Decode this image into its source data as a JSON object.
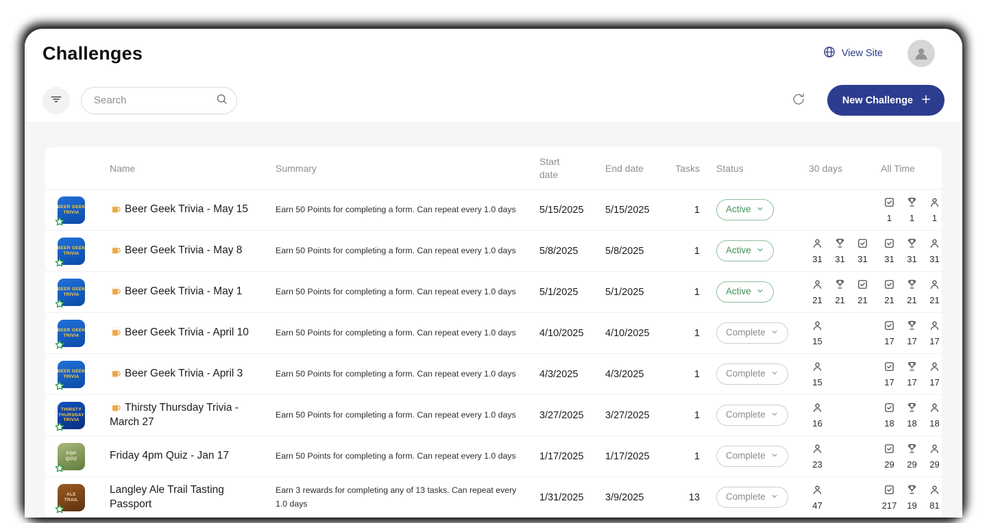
{
  "colors": {
    "accent": "#2c3d8f",
    "active": "#3f9257",
    "complete": "#8b8b8b"
  },
  "header": {
    "title": "Challenges",
    "view_site_label": "View Site"
  },
  "toolbar": {
    "search_placeholder": "Search",
    "new_challenge_label": "New Challenge"
  },
  "table": {
    "headers": {
      "name": "Name",
      "summary": "Summary",
      "start": "Start date",
      "end": "End date",
      "tasks": "Tasks",
      "status": "Status",
      "days30": "30 days",
      "all_time": "All Time"
    },
    "rows": [
      {
        "thumb": {
          "bg_top": "#2270d8",
          "bg_bottom": "#0b4ba8",
          "fg": "#ffce3c",
          "lines": [
            "BEER GEEK",
            "TRIVIA"
          ]
        },
        "beer_icon": true,
        "name": "Beer Geek Trivia - May 15",
        "summary": "Earn 50 Points for completing a form. Can repeat every 1.0 days",
        "start": "5/15/2025",
        "end": "5/15/2025",
        "tasks": "1",
        "status": {
          "label": "Active",
          "kind": "active"
        },
        "stats_30": [],
        "stats_all": [
          {
            "icon": "check",
            "value": "1"
          },
          {
            "icon": "trophy",
            "value": "1"
          },
          {
            "icon": "person",
            "value": "1"
          }
        ]
      },
      {
        "thumb": {
          "bg_top": "#2270d8",
          "bg_bottom": "#0b4ba8",
          "fg": "#ffce3c",
          "lines": [
            "BEER GEEK",
            "TRIVIA"
          ]
        },
        "beer_icon": true,
        "name": "Beer Geek Trivia - May 8",
        "summary": "Earn 50 Points for completing a form. Can repeat every 1.0 days",
        "start": "5/8/2025",
        "end": "5/8/2025",
        "tasks": "1",
        "status": {
          "label": "Active",
          "kind": "active"
        },
        "stats_30": [
          {
            "icon": "person",
            "value": "31"
          },
          {
            "icon": "trophy",
            "value": "31"
          },
          {
            "icon": "check",
            "value": "31"
          }
        ],
        "stats_all": [
          {
            "icon": "check",
            "value": "31"
          },
          {
            "icon": "trophy",
            "value": "31"
          },
          {
            "icon": "person",
            "value": "31"
          }
        ]
      },
      {
        "thumb": {
          "bg_top": "#2270d8",
          "bg_bottom": "#0b4ba8",
          "fg": "#ffce3c",
          "lines": [
            "BEER GEEK",
            "TRIVIA"
          ]
        },
        "beer_icon": true,
        "name": "Beer Geek Trivia - May 1",
        "summary": "Earn 50 Points for completing a form. Can repeat every 1.0 days",
        "start": "5/1/2025",
        "end": "5/1/2025",
        "tasks": "1",
        "status": {
          "label": "Active",
          "kind": "active"
        },
        "stats_30": [
          {
            "icon": "person",
            "value": "21"
          },
          {
            "icon": "trophy",
            "value": "21"
          },
          {
            "icon": "check",
            "value": "21"
          }
        ],
        "stats_all": [
          {
            "icon": "check",
            "value": "21"
          },
          {
            "icon": "trophy",
            "value": "21"
          },
          {
            "icon": "person",
            "value": "21"
          }
        ]
      },
      {
        "thumb": {
          "bg_top": "#2270d8",
          "bg_bottom": "#0b4ba8",
          "fg": "#ffce3c",
          "lines": [
            "BEER GEEK",
            "TRIVIA"
          ]
        },
        "beer_icon": true,
        "name": "Beer Geek Trivia - April 10",
        "summary": "Earn 50 Points for completing a form. Can repeat every 1.0 days",
        "start": "4/10/2025",
        "end": "4/10/2025",
        "tasks": "1",
        "status": {
          "label": "Complete",
          "kind": "complete"
        },
        "stats_30": [
          {
            "icon": "person",
            "value": "15"
          }
        ],
        "stats_all": [
          {
            "icon": "check",
            "value": "17"
          },
          {
            "icon": "trophy",
            "value": "17"
          },
          {
            "icon": "person",
            "value": "17"
          }
        ]
      },
      {
        "thumb": {
          "bg_top": "#2270d8",
          "bg_bottom": "#0b4ba8",
          "fg": "#ffce3c",
          "lines": [
            "BEER GEEK",
            "TRIVIA"
          ]
        },
        "beer_icon": true,
        "name": "Beer Geek Trivia - April 3",
        "summary": "Earn 50 Points for completing a form. Can repeat every 1.0 days",
        "start": "4/3/2025",
        "end": "4/3/2025",
        "tasks": "1",
        "status": {
          "label": "Complete",
          "kind": "complete"
        },
        "stats_30": [
          {
            "icon": "person",
            "value": "15"
          }
        ],
        "stats_all": [
          {
            "icon": "check",
            "value": "17"
          },
          {
            "icon": "trophy",
            "value": "17"
          },
          {
            "icon": "person",
            "value": "17"
          }
        ]
      },
      {
        "thumb": {
          "bg_top": "#1250c0",
          "bg_bottom": "#0a2f80",
          "fg": "#ffce3c",
          "lines": [
            "THIRSTY",
            "THURSDAY",
            "TRIVIA"
          ]
        },
        "beer_icon": true,
        "name": "Thirsty Thursday Trivia - March 27",
        "summary": "Earn 50 Points for completing a form. Can repeat every 1.0 days",
        "start": "3/27/2025",
        "end": "3/27/2025",
        "tasks": "1",
        "status": {
          "label": "Complete",
          "kind": "complete"
        },
        "stats_30": [
          {
            "icon": "person",
            "value": "16"
          }
        ],
        "stats_all": [
          {
            "icon": "check",
            "value": "18"
          },
          {
            "icon": "trophy",
            "value": "18"
          },
          {
            "icon": "person",
            "value": "18"
          }
        ]
      },
      {
        "thumb": {
          "bg_top": "#a8b87a",
          "bg_bottom": "#5f7c3a",
          "fg": "#f3eeda",
          "lines": [
            "Pop",
            "Quiz"
          ]
        },
        "beer_icon": false,
        "name": "Friday 4pm Quiz - Jan 17",
        "summary": "Earn 50 Points for completing a form. Can repeat every 1.0 days",
        "start": "1/17/2025",
        "end": "1/17/2025",
        "tasks": "1",
        "status": {
          "label": "Complete",
          "kind": "complete"
        },
        "stats_30": [
          {
            "icon": "person",
            "value": "23"
          }
        ],
        "stats_all": [
          {
            "icon": "check",
            "value": "29"
          },
          {
            "icon": "trophy",
            "value": "29"
          },
          {
            "icon": "person",
            "value": "29"
          }
        ]
      },
      {
        "thumb": {
          "bg_top": "#9c5b24",
          "bg_bottom": "#5c3211",
          "fg": "#f6d9a8",
          "lines": [
            "ALE",
            "TRAIL"
          ]
        },
        "beer_icon": false,
        "name": "Langley Ale Trail Tasting Passport",
        "summary": "Earn 3 rewards for completing any of 13 tasks. Can repeat every 1.0 days",
        "start": "1/31/2025",
        "end": "3/9/2025",
        "tasks": "13",
        "status": {
          "label": "Complete",
          "kind": "complete"
        },
        "stats_30": [
          {
            "icon": "person",
            "value": "47"
          }
        ],
        "stats_all": [
          {
            "icon": "check",
            "value": "217"
          },
          {
            "icon": "trophy",
            "value": "19"
          },
          {
            "icon": "person",
            "value": "81"
          }
        ]
      }
    ]
  }
}
